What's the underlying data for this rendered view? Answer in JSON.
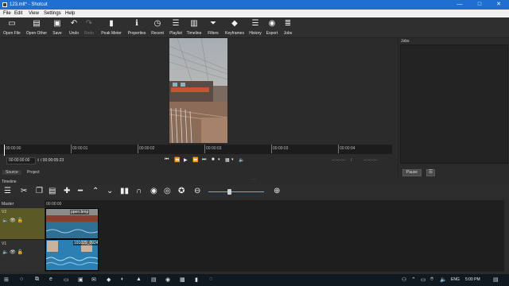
{
  "window": {
    "title": "123.mlt* - Shotcut",
    "controls": {
      "minimize": "—",
      "maximize": "□",
      "close": "✕"
    }
  },
  "menu": [
    "File",
    "Edit",
    "View",
    "Settings",
    "Help"
  ],
  "toolbar": [
    {
      "label": "Open File",
      "icon": "folder-open-icon",
      "glyph": "▭",
      "enabled": true
    },
    {
      "label": "Open Other",
      "icon": "open-other-icon",
      "glyph": "▤",
      "enabled": true
    },
    {
      "label": "Save",
      "icon": "save-icon",
      "glyph": "▣",
      "enabled": true
    },
    {
      "label": "Undo",
      "icon": "undo-icon",
      "glyph": "↶",
      "enabled": true
    },
    {
      "label": "Redo",
      "icon": "redo-icon",
      "glyph": "↷",
      "enabled": false
    },
    {
      "label": "Peak Meter",
      "icon": "peak-meter-icon",
      "glyph": "▮",
      "enabled": true
    },
    {
      "label": "Properties",
      "icon": "properties-icon",
      "glyph": "ℹ",
      "enabled": true
    },
    {
      "label": "Recent",
      "icon": "recent-icon",
      "glyph": "◷",
      "enabled": true
    },
    {
      "label": "Playlist",
      "icon": "playlist-icon",
      "glyph": "☰",
      "enabled": true
    },
    {
      "label": "Timeline",
      "icon": "timeline-icon",
      "glyph": "▥",
      "enabled": true
    },
    {
      "label": "Filters",
      "icon": "filters-icon",
      "glyph": "⏷",
      "enabled": true
    },
    {
      "label": "Keyframes",
      "icon": "keyframes-icon",
      "glyph": "◆",
      "enabled": true
    },
    {
      "label": "History",
      "icon": "history-icon",
      "glyph": "☰",
      "enabled": true
    },
    {
      "label": "Export",
      "icon": "export-icon",
      "glyph": "◉",
      "enabled": true
    },
    {
      "label": "Jobs",
      "icon": "jobs-icon",
      "glyph": "≣",
      "enabled": true
    }
  ],
  "ruler": [
    "00:00:00",
    "00:00:01",
    "00:00:02",
    "00:00:03",
    "00:00:03",
    "00:00:04"
  ],
  "transport": {
    "position": "00:00:00:00",
    "duration": "/ 00:00:05:23",
    "in_point": "--:--:--:--",
    "out_sep": "/",
    "out_point": "--:--:--:--"
  },
  "source_tabs": [
    "Source",
    "Project"
  ],
  "jobs": {
    "title": "Jobs",
    "pause_label": "Pause",
    "menu_glyph": "☰"
  },
  "timeline": {
    "title": "Timeline",
    "master_label": "Master",
    "ruler_start": "00:00:00",
    "tracks": [
      {
        "name": "V2",
        "clip_label": "ppen.bmp"
      },
      {
        "name": "V1",
        "clip_label": "191029_0924"
      }
    ]
  },
  "taskbar": {
    "lang": "ENG",
    "time": "5:00 PM"
  }
}
